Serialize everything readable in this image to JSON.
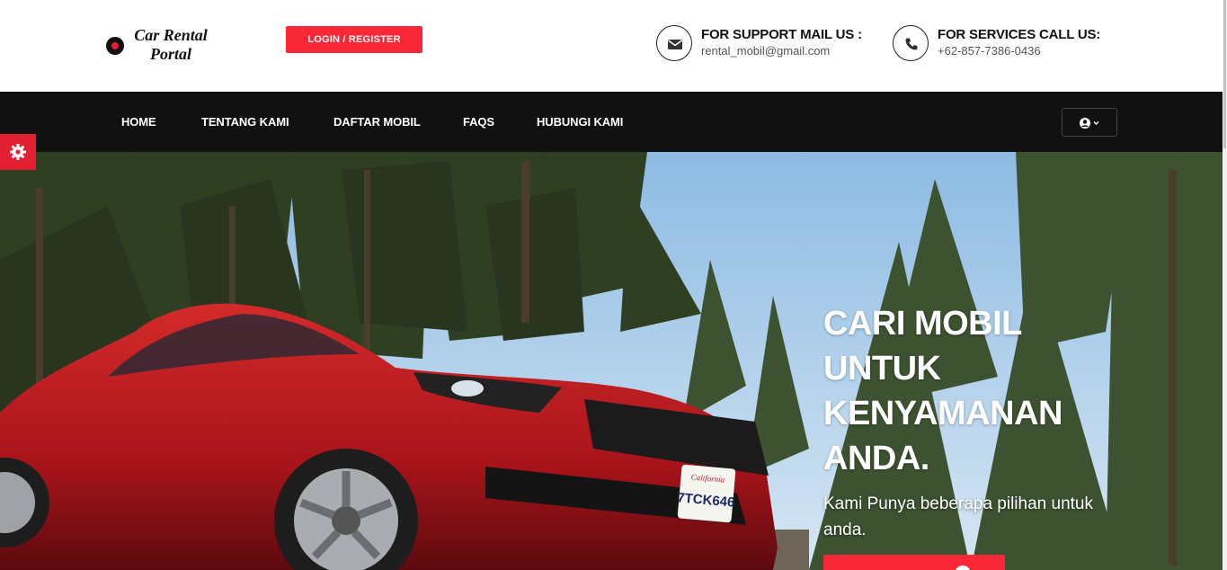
{
  "header": {
    "logo": {
      "line1": "Car Rental",
      "line2": "Portal"
    },
    "login_button": "LOGIN / REGISTER",
    "support": {
      "title": "FOR SUPPORT MAIL US :",
      "value": "rental_mobil@gmail.com",
      "icon": "envelope-icon"
    },
    "services": {
      "title": "FOR SERVICES CALL US:",
      "value": "+62-857-7386-0436",
      "icon": "phone-icon"
    }
  },
  "nav": {
    "items": [
      {
        "label": "HOME"
      },
      {
        "label": "TENTANG KAMI"
      },
      {
        "label": "DAFTAR MOBIL"
      },
      {
        "label": "FAQS"
      },
      {
        "label": "HUBUNGI KAMI"
      }
    ],
    "user_menu_icon": "user-circle-icon"
  },
  "hero": {
    "title": "CARI MOBIL UNTUK KENYAMANAN ANDA.",
    "subtitle": "Kami Punya beberapa pilihan untuk anda.",
    "plate_state": "California",
    "plate_number": "7TCK646"
  },
  "settings_icon": "gear-icon",
  "colors": {
    "accent": "#fa2837",
    "nav_bg": "#111111"
  }
}
